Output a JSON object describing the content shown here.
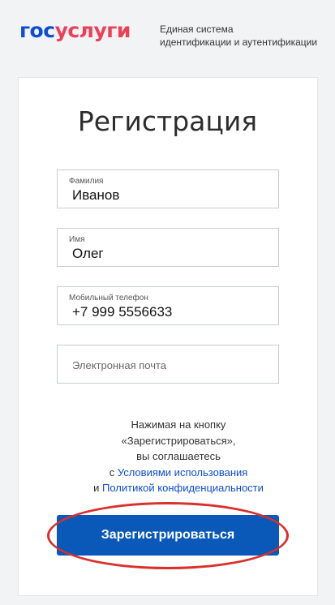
{
  "header": {
    "logo_part1": "гос",
    "logo_part2": "услуги",
    "tagline_line1": "Единая система",
    "tagline_line2": "идентификации и аутентификации"
  },
  "form": {
    "title": "Регистрация",
    "lastname": {
      "label": "Фамилия",
      "value": "Иванов"
    },
    "firstname": {
      "label": "Имя",
      "value": "Олег"
    },
    "phone": {
      "label": "Мобильный телефон",
      "value": "+7 999 5556633"
    },
    "email": {
      "placeholder": "Электронная почта"
    }
  },
  "consent": {
    "line1": "Нажимая на кнопку",
    "line2": "«Зарегистрироваться»,",
    "line3": "вы соглашаетесь",
    "line4_prefix": "с ",
    "terms_link": "Условиями использования",
    "line5_prefix": "и ",
    "privacy_link": "Политикой конфиденциальности"
  },
  "register_button": {
    "label": "Зарегистрироваться"
  },
  "colors": {
    "brand_blue": "#0d4cd3",
    "brand_red": "#ee3f58",
    "button_blue": "#0a58b8",
    "highlight_red": "#d9302b"
  }
}
